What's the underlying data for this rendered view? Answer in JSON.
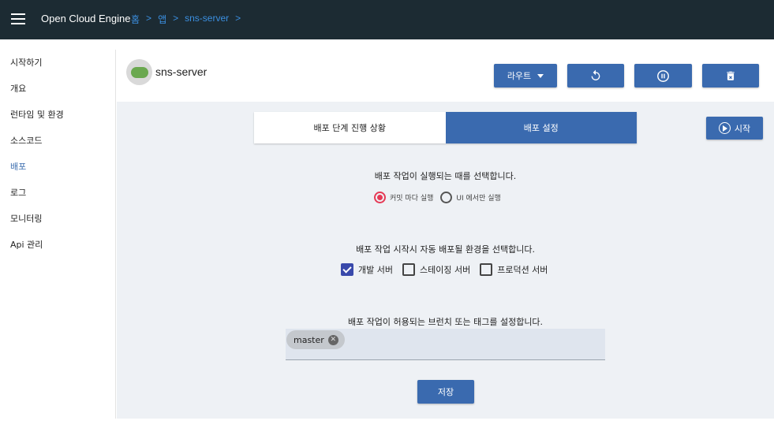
{
  "topbar": {
    "menu_icon": "hamburger-menu-icon",
    "title": "Open Cloud Engine",
    "breadcrumb": [
      {
        "label": "홈"
      },
      {
        "label": "앱"
      },
      {
        "label": "sns-server"
      }
    ],
    "separator": ">"
  },
  "sidebar": {
    "items": [
      {
        "label": "시작하기"
      },
      {
        "label": "개요"
      },
      {
        "label": "런타임 및 환경"
      },
      {
        "label": "소스코드"
      },
      {
        "label": "배포",
        "active": true
      },
      {
        "label": "로그"
      },
      {
        "label": "모니터링"
      },
      {
        "label": "Api 관리"
      }
    ]
  },
  "app": {
    "name": "sns-server",
    "avatar_icon": "spring-boot-logo",
    "avatar_text": "Spring Boot"
  },
  "toolbar": {
    "route_label": "라우트",
    "refresh_icon": "refresh-icon",
    "pause_icon": "pause-circle-icon",
    "delete_icon": "delete-icon"
  },
  "tabs": [
    {
      "label": "배포 단계 진행 상황",
      "active": false
    },
    {
      "label": "배포 설정",
      "active": true
    }
  ],
  "start_button": {
    "label": "시작",
    "icon": "play-circle-icon"
  },
  "deploy_trigger": {
    "title": "배포 작업이 실행되는 때를 선택합니다.",
    "options": [
      {
        "label": "커밋 마다 실행",
        "selected": true
      },
      {
        "label": "UI 에서만 실행",
        "selected": false
      }
    ]
  },
  "deploy_env": {
    "title": "배포 작업 시작시 자동 배포될 환경을 선택합니다.",
    "options": [
      {
        "label": "개발 서버",
        "checked": true
      },
      {
        "label": "스테이징 서버",
        "checked": false
      },
      {
        "label": "프로덕션 서버",
        "checked": false
      }
    ]
  },
  "branches": {
    "title": "배포 작업이 허용되는 브런치 또는 태그를 설정합니다.",
    "chips": [
      {
        "label": "master"
      }
    ]
  },
  "save_label": "저장",
  "colors": {
    "topbar": "#1c2b33",
    "primary": "#3a6aaf",
    "link": "#3b8fe0",
    "radio_selected": "#e53955",
    "checkbox_checked": "#3949ab",
    "content_bg": "#eef1f5"
  }
}
